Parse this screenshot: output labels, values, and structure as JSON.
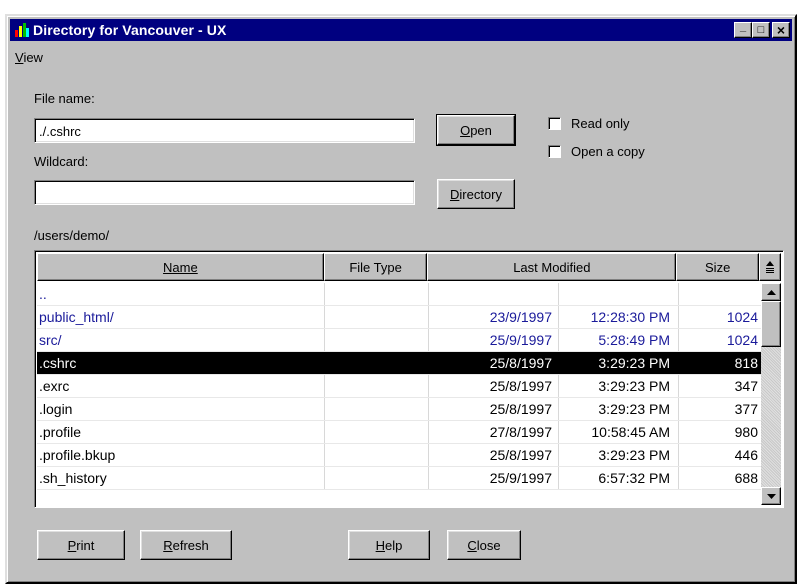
{
  "window": {
    "title": "Directory for Vancouver - UX"
  },
  "titlebar_buttons": {
    "minimize": "_",
    "maximize": "□",
    "close": "×"
  },
  "menu": {
    "view_mnemonic": "V",
    "view_rest": "iew"
  },
  "form": {
    "file_name_label": "File name:",
    "file_name_value": "./.cshrc",
    "wildcard_label": "Wildcard:",
    "wildcard_value": "",
    "open_mnemonic": "O",
    "open_rest": "pen",
    "directory_mnemonic": "D",
    "directory_rest": "irectory",
    "read_only_label": "Read only",
    "read_only_checked": false,
    "open_copy_label": "Open a copy",
    "open_copy_checked": false
  },
  "path": "/users/demo/",
  "columns": {
    "name": "Name",
    "file_type": "File Type",
    "last_modified": "Last Modified",
    "size": "Size"
  },
  "files": [
    {
      "name": "..",
      "type": "",
      "date": "",
      "time": "",
      "size": "",
      "dir": true
    },
    {
      "name": "public_html/",
      "type": "",
      "date": "23/9/1997",
      "time": "12:28:30 PM",
      "size": "1024",
      "dir": true
    },
    {
      "name": "src/",
      "type": "",
      "date": "25/9/1997",
      "time": "5:28:49 PM",
      "size": "1024",
      "dir": true
    },
    {
      "name": ".cshrc",
      "type": "",
      "date": "25/8/1997",
      "time": "3:29:23 PM",
      "size": "818",
      "selected": true
    },
    {
      "name": ".exrc",
      "type": "",
      "date": "25/8/1997",
      "time": "3:29:23 PM",
      "size": "347"
    },
    {
      "name": ".login",
      "type": "",
      "date": "25/8/1997",
      "time": "3:29:23 PM",
      "size": "377"
    },
    {
      "name": ".profile",
      "type": "",
      "date": "27/8/1997",
      "time": "10:58:45 AM",
      "size": "980"
    },
    {
      "name": ".profile.bkup",
      "type": "",
      "date": "25/8/1997",
      "time": "3:29:23 PM",
      "size": "446"
    },
    {
      "name": ".sh_history",
      "type": "",
      "date": "25/9/1997",
      "time": "6:57:32 PM",
      "size": "688"
    }
  ],
  "buttons": {
    "print_mnemonic": "P",
    "print_rest": "rint",
    "refresh_mnemonic": "R",
    "refresh_rest": "efresh",
    "help_mnemonic": "H",
    "help_rest": "elp",
    "close_mnemonic": "C",
    "close_rest": "lose"
  },
  "colors": {
    "titlebar": "#000080",
    "directory_text": "#1a1a9a",
    "selection": "#000000",
    "face": "#c0c0c0"
  }
}
